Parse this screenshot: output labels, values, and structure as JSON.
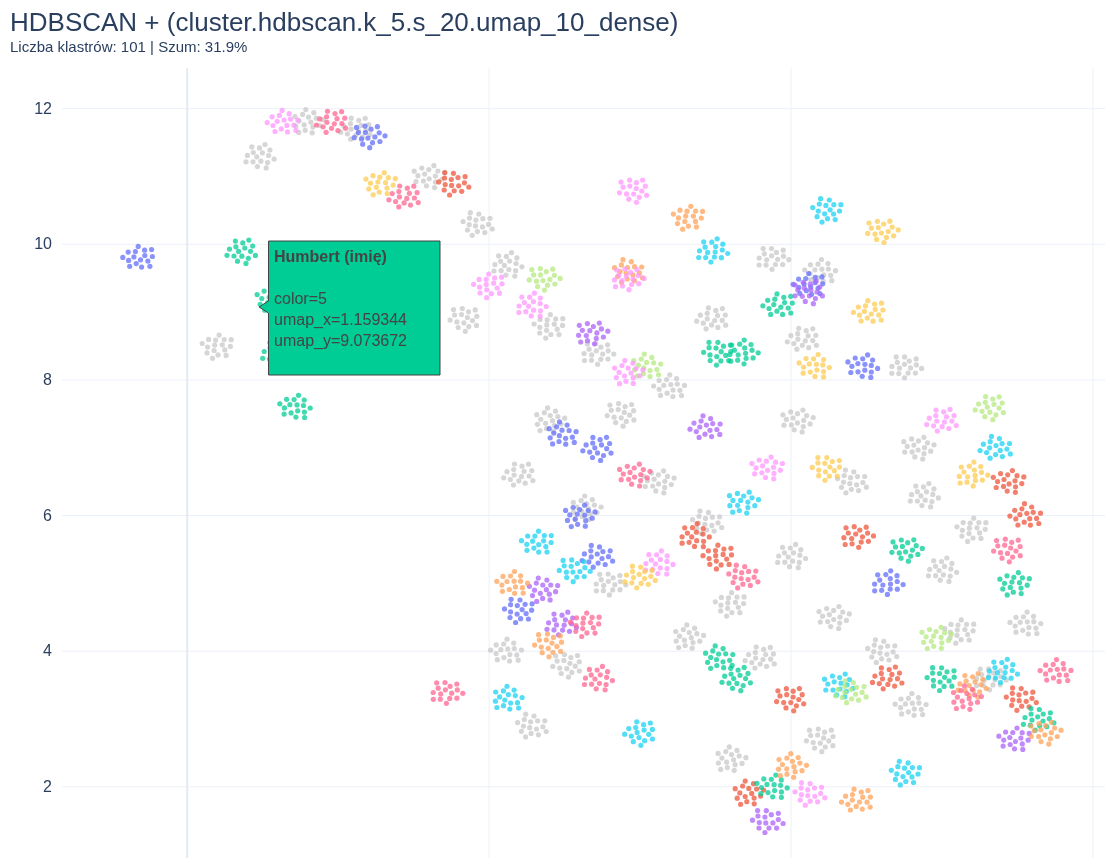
{
  "title": "HDBSCAN + (cluster.hdbscan.k_5.s_20.umap_10_dense)",
  "subtitle": "Liczba klastrów: 101 | Szum: 31.9%",
  "y_axis_ticks": [
    "12",
    "10",
    "8",
    "6",
    "4",
    "2"
  ],
  "tooltip": {
    "title": "Humbert (imię)",
    "lines": [
      "color=5",
      "umap_x=1.159344",
      "umap_y=9.073672"
    ]
  }
}
